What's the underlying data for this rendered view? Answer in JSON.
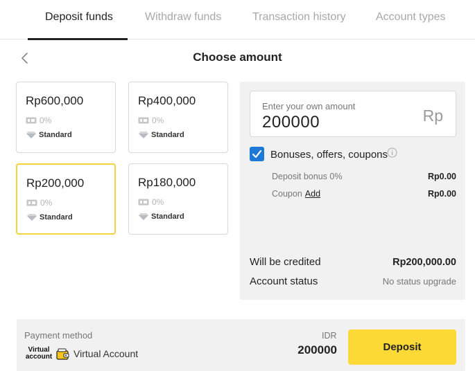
{
  "tabs": [
    {
      "label": "Deposit funds",
      "active": true
    },
    {
      "label": "Withdraw funds",
      "active": false
    },
    {
      "label": "Transaction history",
      "active": false
    },
    {
      "label": "Account types",
      "active": false
    }
  ],
  "header": {
    "title": "Choose amount",
    "back_icon": "chevron-left-icon"
  },
  "cards": [
    {
      "amount": "Rp600,000",
      "bonus": "0%",
      "type": "Standard",
      "selected": false
    },
    {
      "amount": "Rp400,000",
      "bonus": "0%",
      "type": "Standard",
      "selected": false
    },
    {
      "amount": "Rp200,000",
      "bonus": "0%",
      "type": "Standard",
      "selected": true
    },
    {
      "amount": "Rp180,000",
      "bonus": "0%",
      "type": "Standard",
      "selected": false
    }
  ],
  "amount_input": {
    "label": "Enter your own amount",
    "value": "200000",
    "currency": "Rp"
  },
  "bonuses": {
    "checked": true,
    "label": "Bonuses, offers, coupons",
    "deposit_bonus_label": "Deposit bonus 0%",
    "deposit_bonus_value": "Rp0.00",
    "coupon_label": "Coupon",
    "coupon_action": "Add",
    "coupon_value": "Rp0.00"
  },
  "summary": {
    "credited_label": "Will be credited",
    "credited_value": "Rp200,000.00",
    "status_label": "Account status",
    "status_value": "No status upgrade"
  },
  "footer": {
    "payment_method_label": "Payment method",
    "logo_text_line1": "Virtual",
    "logo_text_line2": "account",
    "method_name": "Virtual Account",
    "currency": "IDR",
    "amount": "200000",
    "deposit_label": "Deposit"
  },
  "colors": {
    "accent": "#fcd937",
    "selected_border": "#f5d33c",
    "checkbox": "#1d78d6",
    "panel_bg": "#f1f1f1"
  }
}
